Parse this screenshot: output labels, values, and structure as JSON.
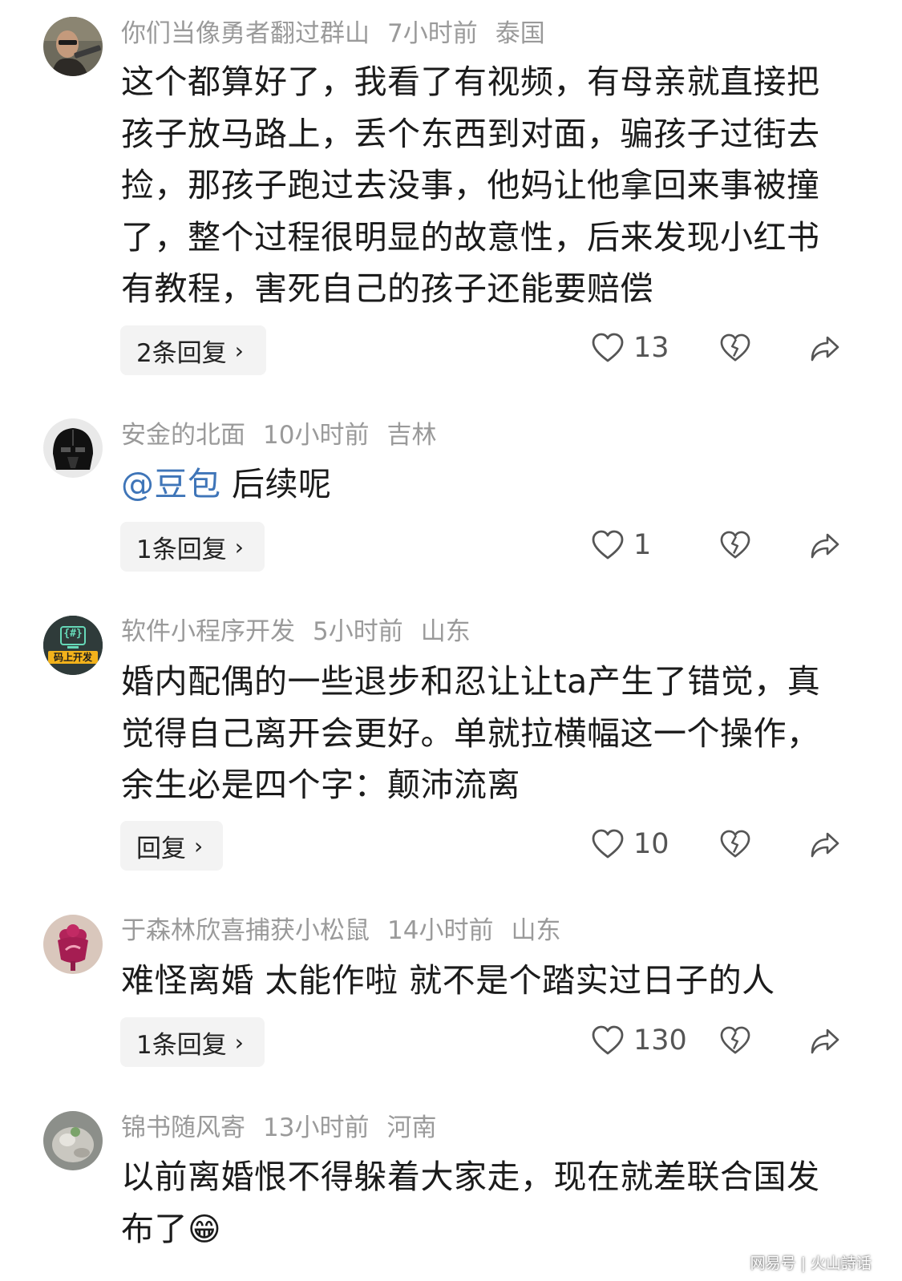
{
  "comments": [
    {
      "username": "你们当像勇者翻过群山",
      "time": "7小时前",
      "location": "泰国",
      "lines": [
        "这个都算好了，我看了有视频，有母亲就直接把",
        "孩子放马路上，丢个东西到对面，骗孩子过街去",
        "捡，那孩子跑过去没事，他妈让他拿回来事被撞",
        "了，整个过程很明显的故意性，后来发现小红书",
        "有教程，害死自己的孩子还能要赔偿"
      ],
      "reply_label": "2条回复",
      "likes": "13"
    },
    {
      "username": "安金的北面",
      "time": "10小时前",
      "location": "吉林",
      "mention": "@豆包",
      "text": "后续呢",
      "reply_label": "1条回复",
      "likes": "1"
    },
    {
      "username": "软件小程序开发",
      "time": "5小时前",
      "location": "山东",
      "avatar_text": "码上开发",
      "avatar_symbol": "{#}",
      "lines": [
        "婚内配偶的一些退步和忍让让ta产生了错觉，真",
        "觉得自己离开会更好。单就拉横幅这一个操作，",
        "余生必是四个字：颠沛流离"
      ],
      "reply_label": "回复",
      "likes": "10"
    },
    {
      "username": "于森林欣喜捕获小松鼠",
      "time": "14小时前",
      "location": "山东",
      "lines": [
        "难怪离婚 太能作啦 就不是个踏实过日子的人"
      ],
      "reply_label": "1条回复",
      "likes": "130"
    },
    {
      "username": "锦书随风寄",
      "time": "13小时前",
      "location": "河南",
      "lines": [
        "以前离婚恨不得躲着大家走，现在就差联合国发",
        "布了"
      ],
      "emoji": "😁"
    }
  ],
  "footer": {
    "source": "网易号",
    "sep": "|",
    "author": "火山詩话"
  },
  "icons": {
    "heart": "heart-outline-icon",
    "dislike": "broken-heart-icon",
    "share": "share-arrow-icon"
  },
  "colors": {
    "mention": "#3f75b8",
    "meta": "#9a9a9a",
    "reply_bg": "#f3f3f3"
  }
}
